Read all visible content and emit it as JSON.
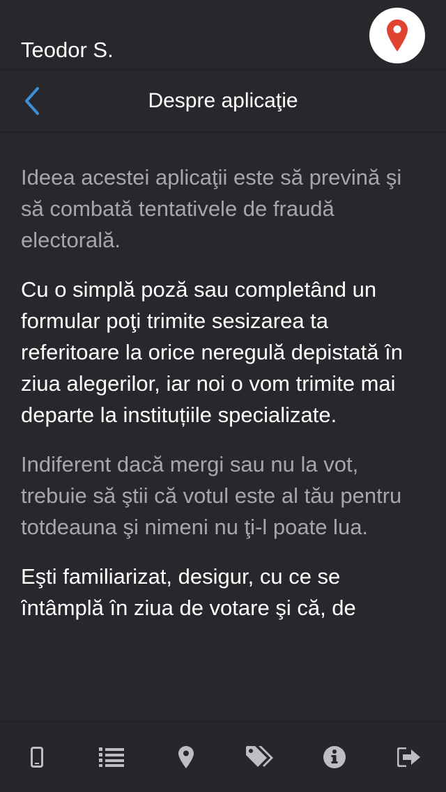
{
  "header": {
    "user_name": "Teodor S.",
    "location_icon": "location-pin-icon"
  },
  "navbar": {
    "back_icon": "chevron-left-icon",
    "title": "Despre aplicaţie"
  },
  "content": {
    "paragraphs": [
      "Ideea acestei aplicaţii este să prevină şi să combată tentativele de fraudă electorală.",
      "Cu o simplă poză sau completând un formular poţi trimite sesizarea ta referitoare la orice neregulă depistată în ziua alegerilor, iar noi o vom trimite mai departe la instituțiile specializate.",
      "Indiferent dacă mergi sau nu la vot, trebuie să ştii că votul este al tău pentru totdeauna şi nimeni nu ţi-l poate lua.",
      "Eşti familiarizat, desigur, cu ce se întâmplă în ziua de votare şi că, de"
    ]
  },
  "tabbar": {
    "items": [
      {
        "icon": "phone-icon"
      },
      {
        "icon": "list-icon"
      },
      {
        "icon": "map-marker-icon"
      },
      {
        "icon": "tags-icon"
      },
      {
        "icon": "info-icon"
      },
      {
        "icon": "sign-out-icon"
      }
    ]
  },
  "colors": {
    "background": "#28272c",
    "accent_blue": "#3d8fd6",
    "pin_red": "#e0432f",
    "text_white": "#ffffff",
    "text_gray": "#a7a6ab"
  }
}
